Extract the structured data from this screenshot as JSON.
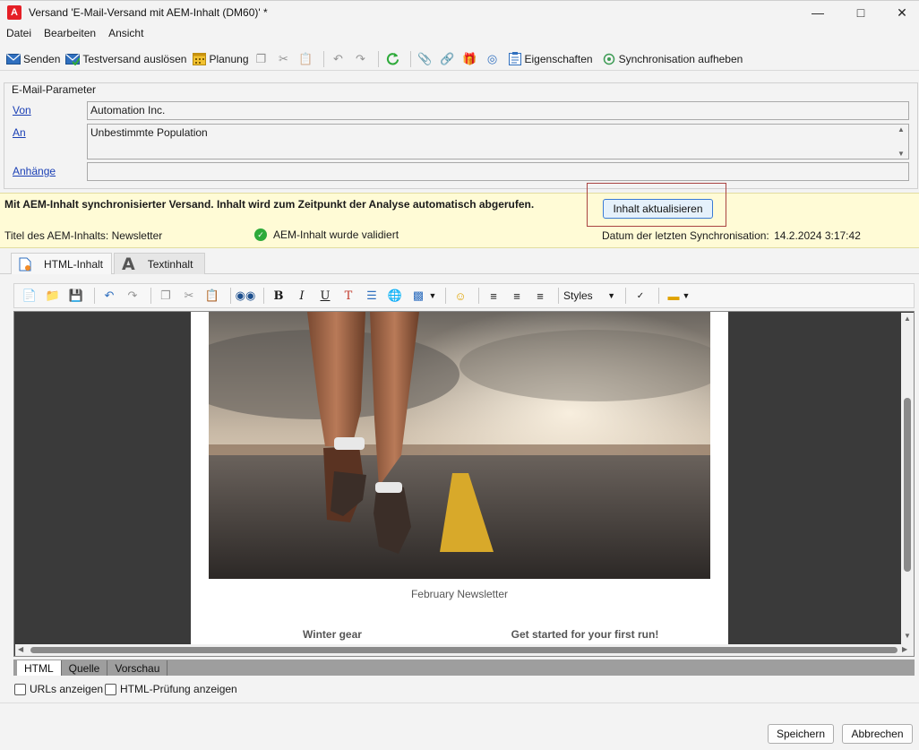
{
  "window": {
    "title": "Versand 'E-Mail-Versand mit AEM-Inhalt (DM60)' *",
    "logo_letter": "A"
  },
  "menu": [
    "Datei",
    "Bearbeiten",
    "Ansicht"
  ],
  "toolbar": {
    "send": "Senden",
    "test_send": "Testversand auslösen",
    "schedule": "Planung",
    "properties": "Eigenschaften",
    "unsync": "Synchronisation aufheben"
  },
  "params": {
    "legend": "E-Mail-Parameter",
    "from_label": "Von",
    "from_value": "Automation Inc.",
    "to_label": "An",
    "to_value": "Unbestimmte Population",
    "attachments_label": "Anhänge",
    "attachments_value": ""
  },
  "aem": {
    "sync_message": "Mit AEM-Inhalt synchronisierter Versand. Inhalt wird zum Zeitpunkt der Analyse automatisch abgerufen.",
    "refresh_button": "Inhalt aktualisieren",
    "title_label": "Titel des AEM-Inhalts: Newsletter",
    "validated": "AEM-Inhalt wurde validiert",
    "last_sync_label": "Datum der letzten Synchronisation:",
    "last_sync_value": "14.2.2024 3:17:42"
  },
  "content_tabs": {
    "html": "HTML-Inhalt",
    "text": "Textinhalt"
  },
  "editor_toolbar": {
    "styles": "Styles"
  },
  "email": {
    "caption": "February Newsletter",
    "col1_heading": "Winter gear",
    "col2_heading": "Get started for your first run!"
  },
  "bottom_tabs": [
    "HTML",
    "Quelle",
    "Vorschau"
  ],
  "options": {
    "show_urls": "URLs anzeigen",
    "show_html_check": "HTML-Prüfung anzeigen"
  },
  "footer": {
    "save": "Speichern",
    "cancel": "Abbrechen"
  },
  "colors": {
    "accent_link": "#1a3fb5",
    "info_band": "#fffbd6",
    "highlight_border": "#a94442"
  }
}
